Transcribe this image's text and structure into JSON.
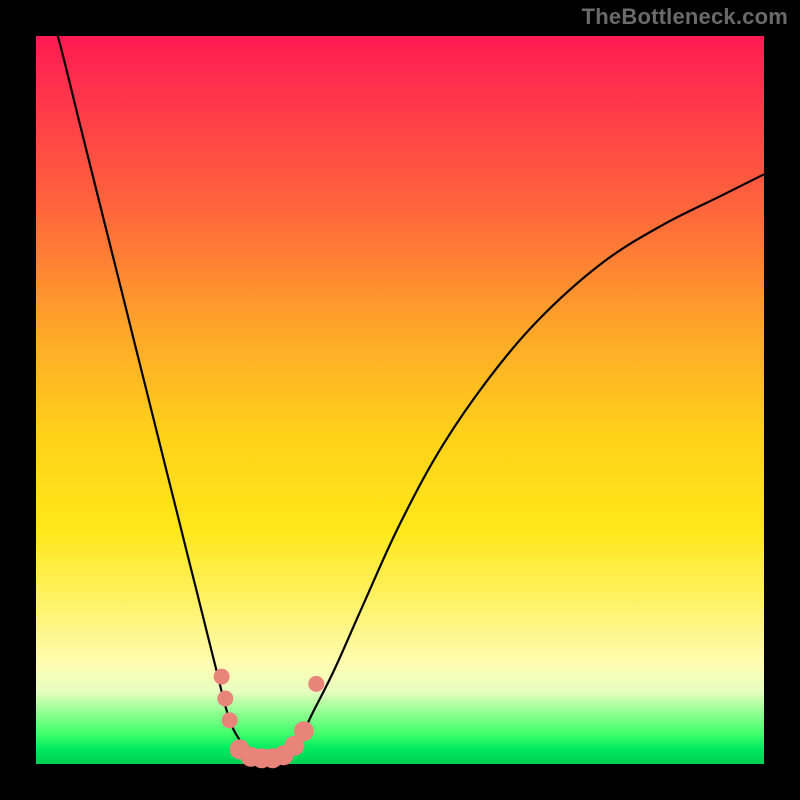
{
  "watermark": "TheBottleneck.com",
  "chart_data": {
    "type": "line",
    "title": "",
    "xlabel": "",
    "ylabel": "",
    "xlim": [
      0,
      100
    ],
    "ylim": [
      0,
      100
    ],
    "grid": false,
    "series": [
      {
        "name": "left-curve",
        "x": [
          0,
          3,
          6,
          9,
          12,
          15,
          18,
          20,
          22,
          24,
          25,
          26,
          27,
          28.5,
          30
        ],
        "values": [
          110,
          100,
          88,
          76,
          64,
          52,
          40,
          32,
          24,
          16,
          12,
          8,
          5,
          2.5,
          0.5
        ]
      },
      {
        "name": "right-curve",
        "x": [
          34,
          36,
          38,
          41,
          45,
          50,
          56,
          63,
          70,
          78,
          86,
          94,
          100
        ],
        "values": [
          0.5,
          3,
          7,
          13,
          22,
          33,
          44,
          54,
          62,
          69,
          74,
          78,
          81
        ]
      }
    ],
    "markers": [
      {
        "x": 25.5,
        "y": 12
      },
      {
        "x": 26.0,
        "y": 9
      },
      {
        "x": 26.6,
        "y": 6
      },
      {
        "x": 28.0,
        "y": 2.0
      },
      {
        "x": 29.5,
        "y": 1.0
      },
      {
        "x": 31.0,
        "y": 0.8
      },
      {
        "x": 32.5,
        "y": 0.8
      },
      {
        "x": 34.0,
        "y": 1.2
      },
      {
        "x": 35.5,
        "y": 2.5
      },
      {
        "x": 36.8,
        "y": 4.5
      },
      {
        "x": 38.5,
        "y": 11
      }
    ],
    "gradient_stops": [
      {
        "pos": 0.0,
        "color": "#ff1a52"
      },
      {
        "pos": 0.25,
        "color": "#ff6a3a"
      },
      {
        "pos": 0.55,
        "color": "#ffd21a"
      },
      {
        "pos": 0.86,
        "color": "#fffcb0"
      },
      {
        "pos": 0.96,
        "color": "#3cff6a"
      },
      {
        "pos": 1.0,
        "color": "#00d050"
      }
    ]
  }
}
